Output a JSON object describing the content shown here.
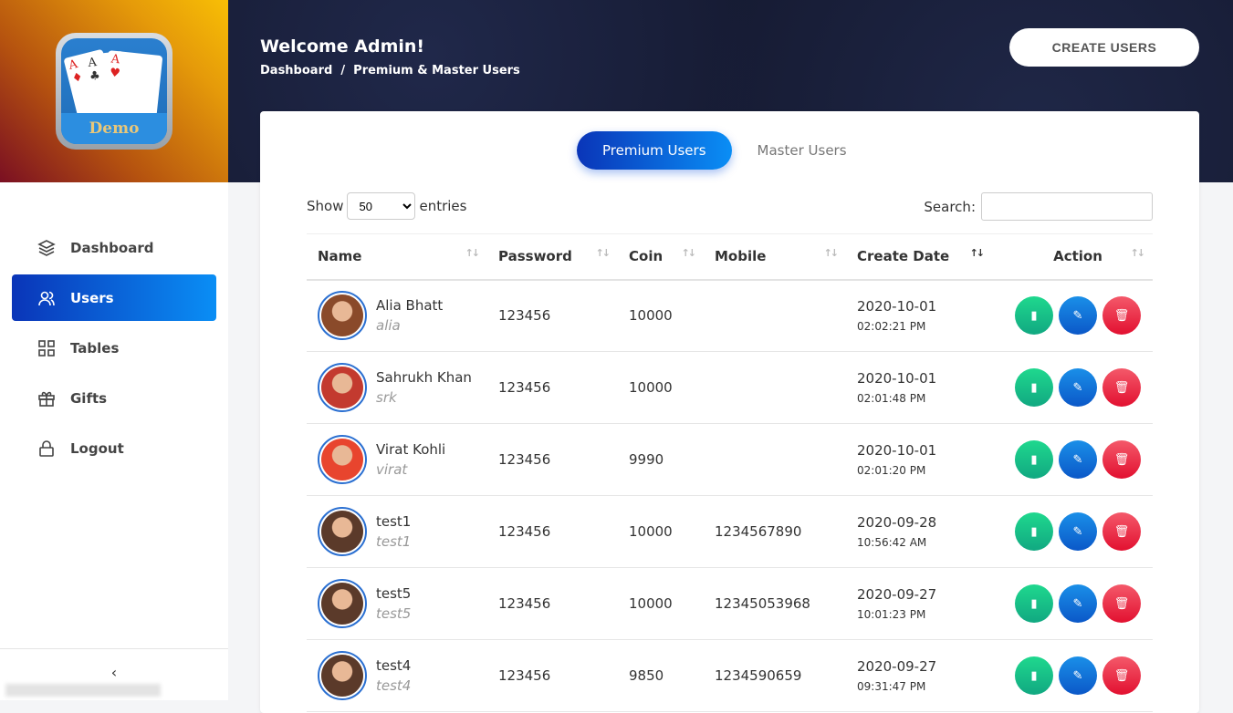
{
  "logo": {
    "text": "Demo"
  },
  "sidebar": {
    "items": [
      {
        "label": "Dashboard",
        "icon": "layers-icon"
      },
      {
        "label": "Users",
        "icon": "users-icon",
        "active": true
      },
      {
        "label": "Tables",
        "icon": "grid-icon"
      },
      {
        "label": "Gifts",
        "icon": "gift-icon"
      },
      {
        "label": "Logout",
        "icon": "lock-icon"
      }
    ],
    "collapse": "‹"
  },
  "header": {
    "title": "Welcome Admin!",
    "breadcrumb": [
      "Dashboard",
      "/",
      "Premium & Master Users"
    ],
    "create_button": "CREATE USERS"
  },
  "tabs": [
    {
      "label": "Premium Users",
      "active": true
    },
    {
      "label": "Master Users"
    }
  ],
  "controls": {
    "show": "Show",
    "entries": "entries",
    "page_size": "50",
    "search_label": "Search:",
    "search_value": ""
  },
  "table": {
    "columns": [
      "Name",
      "Password",
      "Coin",
      "Mobile",
      "Create Date",
      "Action"
    ],
    "rows": [
      {
        "name": "Alia Bhatt",
        "login": "alia",
        "password": "123456",
        "coin": "10000",
        "mobile": "",
        "date": "2020-10-01",
        "time": "02:02:21 PM",
        "avatar": "#8a4a2a"
      },
      {
        "name": "Sahrukh Khan",
        "login": "srk",
        "password": "123456",
        "coin": "10000",
        "mobile": "",
        "date": "2020-10-01",
        "time": "02:01:48 PM",
        "avatar": "#c33a2f"
      },
      {
        "name": "Virat Kohli",
        "login": "virat",
        "password": "123456",
        "coin": "9990",
        "mobile": "",
        "date": "2020-10-01",
        "time": "02:01:20 PM",
        "avatar": "#e8452e"
      },
      {
        "name": "test1",
        "login": "test1",
        "password": "123456",
        "coin": "10000",
        "mobile": "1234567890",
        "date": "2020-09-28",
        "time": "10:56:42 AM",
        "avatar": "#5b3a2a"
      },
      {
        "name": "test5",
        "login": "test5",
        "password": "123456",
        "coin": "10000",
        "mobile": "12345053968",
        "date": "2020-09-27",
        "time": "10:01:23 PM",
        "avatar": "#5b3a2a"
      },
      {
        "name": "test4",
        "login": "test4",
        "password": "123456",
        "coin": "9850",
        "mobile": "1234590659",
        "date": "2020-09-27",
        "time": "09:31:47 PM",
        "avatar": "#5b3a2a"
      }
    ]
  }
}
